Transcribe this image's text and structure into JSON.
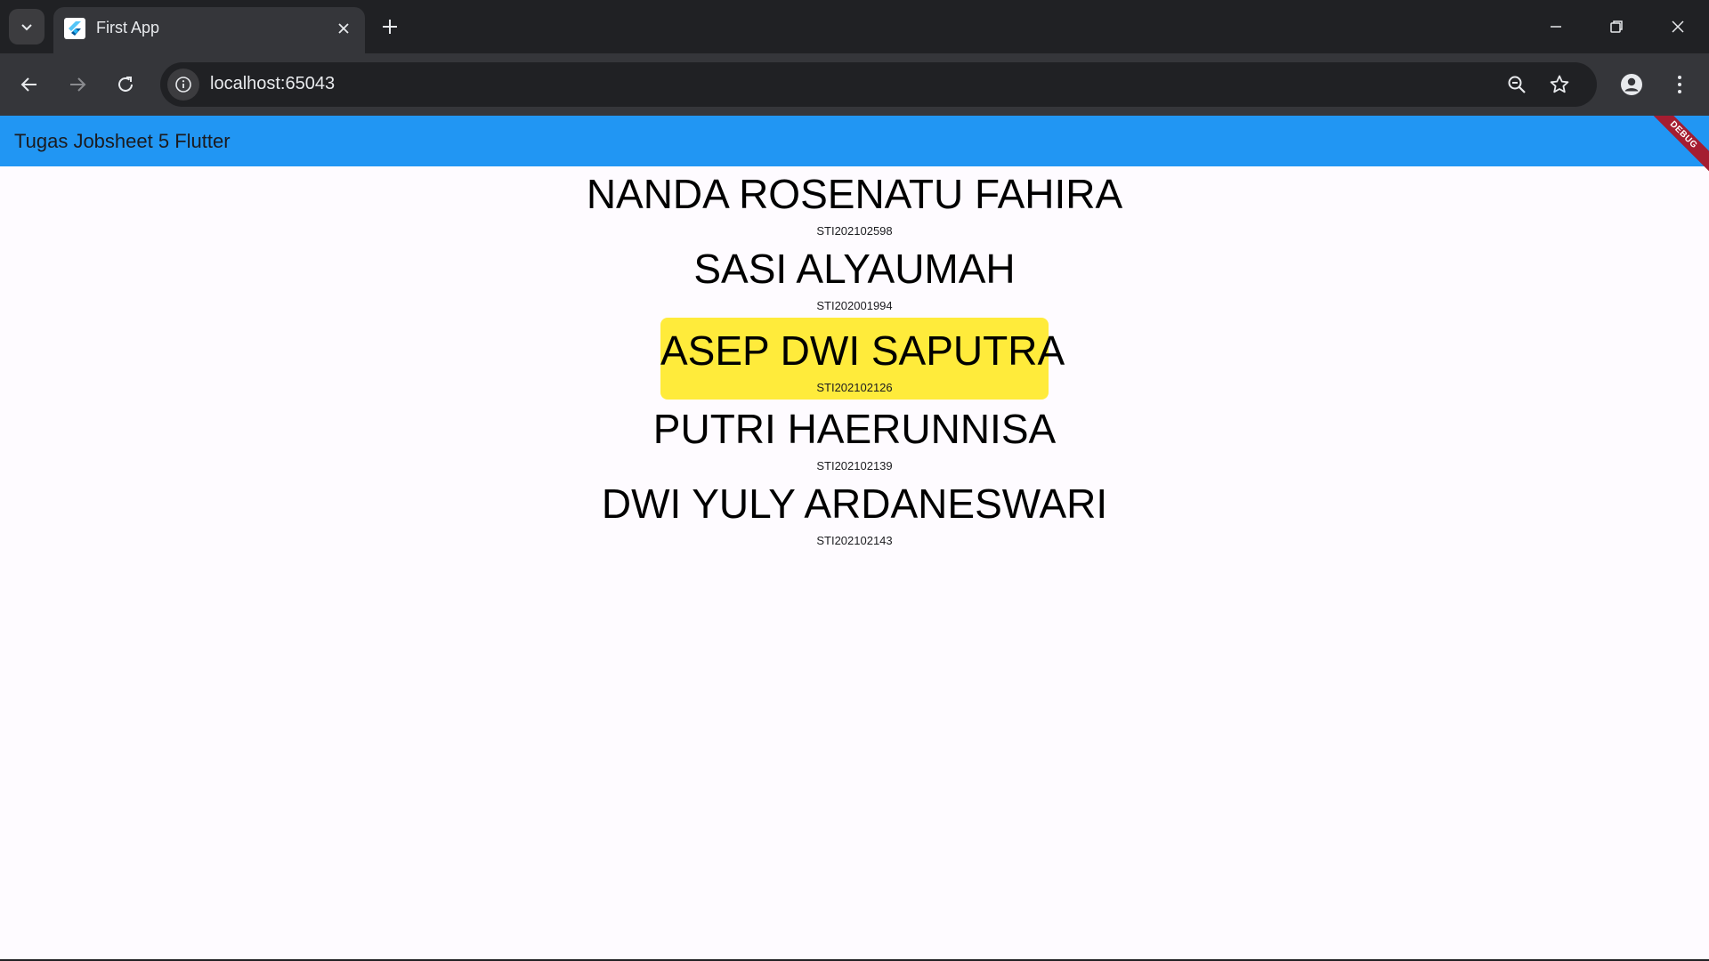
{
  "browser": {
    "tab_title": "First App",
    "url": "localhost:65043",
    "icons": {
      "tab_search": "chevron-down-icon",
      "favicon": "flutter-icon",
      "tab_close": "close-icon",
      "new_tab": "plus-icon",
      "minimize": "minimize-icon",
      "restore": "restore-icon",
      "close_window": "close-icon",
      "back": "arrow-left-icon",
      "forward": "arrow-right-icon",
      "reload": "reload-icon",
      "site_info": "info-icon",
      "zoom": "zoom-out-icon",
      "bookmark": "star-icon",
      "profile": "person-icon",
      "menu": "kebab-menu-icon"
    }
  },
  "app": {
    "title": "Tugas Jobsheet 5 Flutter",
    "debug_banner": "DEBUG",
    "appbar_color": "#2196f3",
    "highlight_color": "#ffeb3b",
    "people": [
      {
        "name": "NANDA ROSENATU FAHIRA",
        "nim": "STI202102598"
      },
      {
        "name": "SASI ALYAUMAH",
        "nim": "STI202001994"
      },
      {
        "name": "ASEP DWI SAPUTRA",
        "nim": "STI202102126"
      },
      {
        "name": "PUTRI HAERUNNISA",
        "nim": "STI202102139"
      },
      {
        "name": "DWI YULY ARDANESWARI",
        "nim": "STI202102143"
      }
    ]
  }
}
